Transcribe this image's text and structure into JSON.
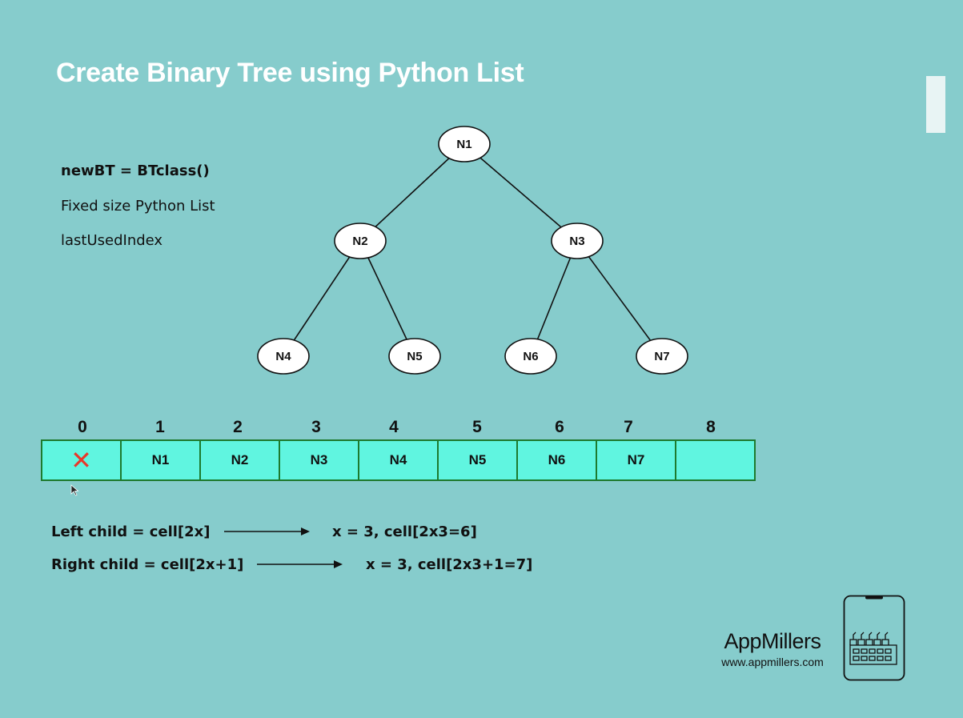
{
  "title": "Create Binary Tree using Python List",
  "notes": [
    "newBT = BTclass()",
    "Fixed size Python List",
    "lastUsedIndex"
  ],
  "tree": {
    "nodes": [
      "N1",
      "N2",
      "N3",
      "N4",
      "N5",
      "N6",
      "N7"
    ],
    "edges": [
      [
        "N1",
        "N2"
      ],
      [
        "N1",
        "N3"
      ],
      [
        "N2",
        "N4"
      ],
      [
        "N2",
        "N5"
      ],
      [
        "N3",
        "N6"
      ],
      [
        "N3",
        "N7"
      ]
    ]
  },
  "list": {
    "indices": [
      "0",
      "1",
      "2",
      "3",
      "4",
      "5",
      "6",
      "7",
      "8"
    ],
    "cells": [
      "",
      "N1",
      "N2",
      "N3",
      "N4",
      "N5",
      "N6",
      "N7",
      ""
    ],
    "unused_mark": "✕"
  },
  "formulas": {
    "left": "Left child = cell[2x]",
    "left_example": "x = 3, cell[2x3=6]",
    "right": "Right child = cell[2x+1]",
    "right_example": "x = 3, cell[2x3+1=7]"
  },
  "brand": {
    "name": "AppMillers",
    "url": "www.appmillers.com"
  },
  "colors": {
    "background": "#86cccc",
    "cell_fill": "#60f5e0",
    "cell_border": "#1e7a2e",
    "x_mark": "#e8372a"
  }
}
